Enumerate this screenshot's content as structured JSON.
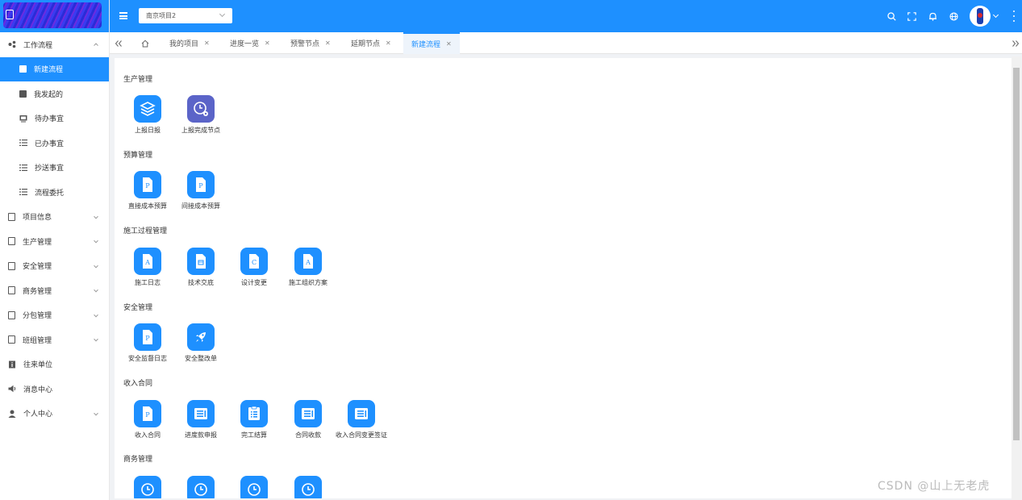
{
  "header": {
    "project_select": "南京项目2",
    "icons": [
      "search-icon",
      "fullscreen-icon",
      "bell-icon",
      "globe-icon"
    ],
    "accent": "#1e90ff"
  },
  "sidebar": {
    "items": [
      {
        "label": "工作流程",
        "icon": "workflow-icon",
        "expanded": true
      },
      {
        "label": "新建流程",
        "icon": "edit-icon",
        "active": true
      },
      {
        "label": "我发起的",
        "icon": "edit-icon"
      },
      {
        "label": "待办事宜",
        "icon": "monitor-icon"
      },
      {
        "label": "已办事宜",
        "icon": "list-icon"
      },
      {
        "label": "抄送事宜",
        "icon": "list-icon"
      },
      {
        "label": "流程委托",
        "icon": "list-icon"
      },
      {
        "label": "项目信息",
        "icon": "document-icon"
      },
      {
        "label": "生产管理",
        "icon": "document-icon"
      },
      {
        "label": "安全管理",
        "icon": "document-icon"
      },
      {
        "label": "商务管理",
        "icon": "document-icon"
      },
      {
        "label": "分包管理",
        "icon": "document-icon"
      },
      {
        "label": "班组管理",
        "icon": "document-icon"
      },
      {
        "label": "往来单位",
        "icon": "info-icon"
      },
      {
        "label": "消息中心",
        "icon": "speaker-icon"
      },
      {
        "label": "个人中心",
        "icon": "user-icon"
      }
    ]
  },
  "tabs": [
    {
      "label": "我的项目"
    },
    {
      "label": "进度一览"
    },
    {
      "label": "预警节点"
    },
    {
      "label": "延期节点"
    },
    {
      "label": "新建流程",
      "active": true
    }
  ],
  "sections": [
    {
      "title": "生产管理",
      "apps": [
        {
          "label": "上报日报",
          "icon": "layers-icon"
        },
        {
          "label": "上报完成节点",
          "icon": "clock-gear-icon"
        }
      ]
    },
    {
      "title": "预算管理",
      "apps": [
        {
          "label": "直接成本预算",
          "icon": "file-p-icon"
        },
        {
          "label": "间接成本预算",
          "icon": "file-p-icon"
        }
      ]
    },
    {
      "title": "施工过程管理",
      "apps": [
        {
          "label": "施工日志",
          "icon": "file-a-icon"
        },
        {
          "label": "技术交底",
          "icon": "file-calendar-icon"
        },
        {
          "label": "设计变更",
          "icon": "file-c-icon"
        },
        {
          "label": "施工组织方案",
          "icon": "file-a-icon"
        }
      ]
    },
    {
      "title": "安全管理",
      "apps": [
        {
          "label": "安全监督日志",
          "icon": "file-p-icon"
        },
        {
          "label": "安全整改单",
          "icon": "rocket-icon"
        }
      ]
    },
    {
      "title": "收入合同",
      "apps": [
        {
          "label": "收入合同",
          "icon": "file-p-icon"
        },
        {
          "label": "进度款申报",
          "icon": "form-icon"
        },
        {
          "label": "完工结算",
          "icon": "checklist-icon"
        },
        {
          "label": "合同收款",
          "icon": "form-icon"
        },
        {
          "label": "收入合同变更签证",
          "icon": "form-icon"
        }
      ]
    },
    {
      "title": "商务管理",
      "apps": [
        {
          "label": "",
          "icon": "clock-icon"
        },
        {
          "label": "",
          "icon": "clock-icon"
        },
        {
          "label": "",
          "icon": "clock-icon"
        },
        {
          "label": "",
          "icon": "clock-icon"
        }
      ]
    }
  ],
  "watermark": "CSDN @山上无老虎"
}
